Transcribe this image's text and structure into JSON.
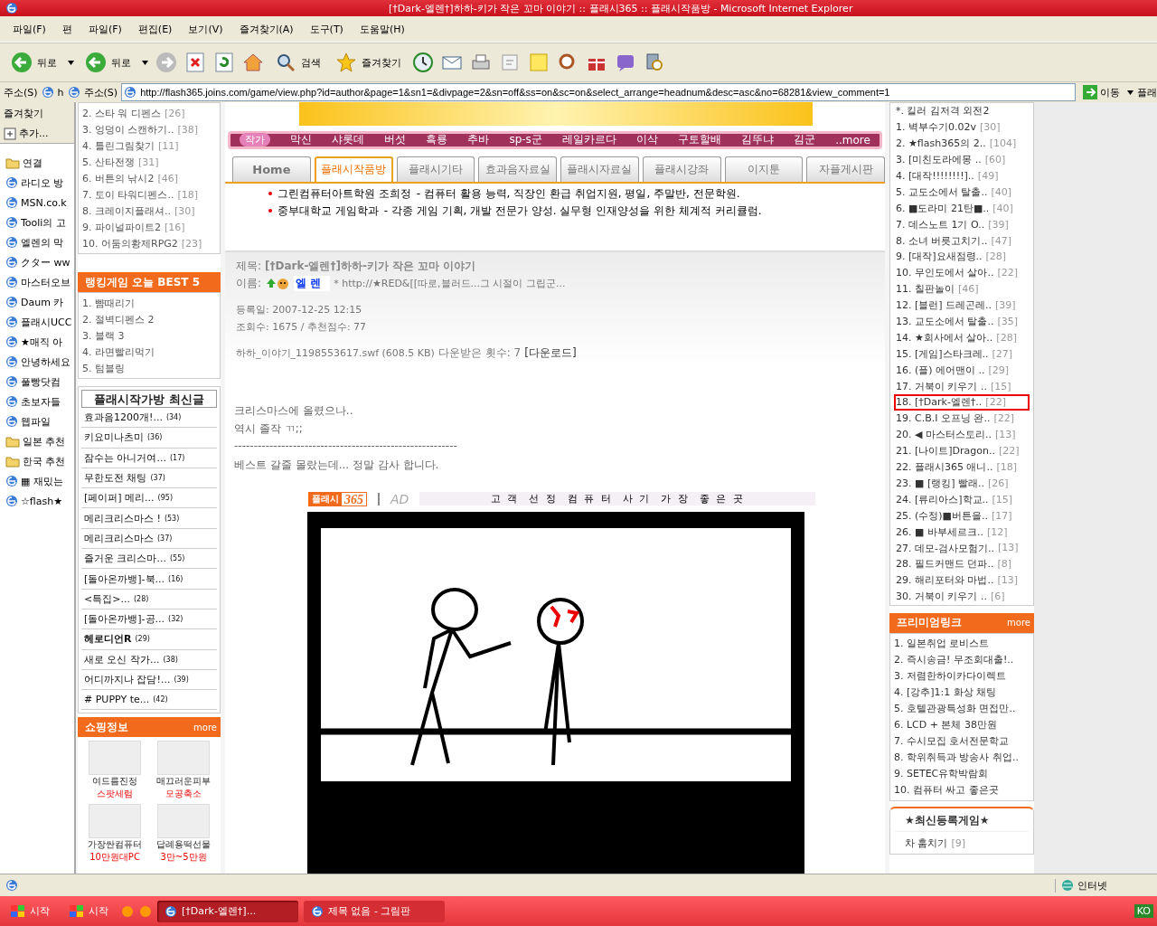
{
  "window": {
    "title": "[†Dark-엘렌†]하하-키가 작은 꼬마 이야기 :: 플래시365 :: 플래시작품방 - Microsoft Internet Explorer"
  },
  "menu": [
    "파일(F)",
    "편",
    "파일(F)",
    "편집(E)",
    "보기(V)",
    "즐겨찾기(A)",
    "도구(T)",
    "도움말(H)"
  ],
  "toolbar": {
    "back_buttons": [
      "뒤로",
      "뒤로"
    ],
    "search": "검색",
    "favorites": "즐겨찾기"
  },
  "address": {
    "labels": [
      "주소(S)",
      "h",
      "주소(S)"
    ],
    "url": "http://flash365.joins.com/game/view.php?id=author&page=1&sn1=&divpage=2&sn=off&ss=on&sc=on&select_arrange=headnum&desc=asc&no=68281&view_comment=1",
    "go": "이동",
    "links": "플래"
  },
  "favorites_pane": {
    "title": "즐겨찾기",
    "add": "추가...",
    "items": [
      {
        "kind": "folder",
        "label": "연결"
      },
      {
        "kind": "page",
        "label": "라디오 방"
      },
      {
        "kind": "page",
        "label": "MSN.co.k"
      },
      {
        "kind": "page",
        "label": "Tooli의 고"
      },
      {
        "kind": "page",
        "label": "엘렌의 막"
      },
      {
        "kind": "page",
        "label": "クター ww"
      },
      {
        "kind": "page",
        "label": "마스터오브"
      },
      {
        "kind": "page",
        "label": "Daum 카"
      },
      {
        "kind": "page",
        "label": "플래시UCC"
      },
      {
        "kind": "page",
        "label": "★매직 아"
      },
      {
        "kind": "page",
        "label": "안녕하세요"
      },
      {
        "kind": "page",
        "label": "풀빵닷컴"
      },
      {
        "kind": "page",
        "label": "초보자들"
      },
      {
        "kind": "page",
        "label": "웹파일"
      },
      {
        "kind": "folder",
        "label": "일본 추천"
      },
      {
        "kind": "folder",
        "label": "한국 추천"
      },
      {
        "kind": "page",
        "label": "▦ 재밌는"
      },
      {
        "kind": "page",
        "label": "☆flash★"
      }
    ]
  },
  "popular": [
    {
      "rank": "2.",
      "title": "스타 워 디펜스",
      "count": "[26]"
    },
    {
      "rank": "3.",
      "title": "엉덩이 스캔하기..",
      "count": "[38]"
    },
    {
      "rank": "4.",
      "title": "틀린그림찾기",
      "count": "[11]"
    },
    {
      "rank": "5.",
      "title": "산타전쟁",
      "count": "[31]"
    },
    {
      "rank": "6.",
      "title": "버튼의 낚시2",
      "count": "[46]"
    },
    {
      "rank": "7.",
      "title": "토이 타워디펜스..",
      "count": "[18]"
    },
    {
      "rank": "8.",
      "title": "크레이지플래셔..",
      "count": "[30]"
    },
    {
      "rank": "9.",
      "title": "파이널파이트2",
      "count": "[16]"
    },
    {
      "rank": "10.",
      "title": "어둠의황제RPG2",
      "count": "[23]"
    }
  ],
  "ranking": {
    "title": "랭킹게임 오늘 BEST 5",
    "items": [
      "1. 뺨때리기",
      "2. 절벽디펜스 2",
      "3. 블랙 3",
      "4. 라면빨리먹기",
      "5. 텀블링"
    ]
  },
  "latest": {
    "title": "플래시작가방 최신글",
    "items": [
      {
        "title": "효과음1200개!...",
        "count": "(34)",
        "bold": false
      },
      {
        "title": "키요미나츠미",
        "count": "(36)",
        "bold": false
      },
      {
        "title": "잠수는 아니거여...",
        "count": "(17)",
        "bold": false
      },
      {
        "title": "무한도전 채팅",
        "count": "(37)",
        "bold": false
      },
      {
        "title": "[페이퍼] 메리...",
        "count": "(95)",
        "bold": false
      },
      {
        "title": "메리크리스마스 !",
        "count": "(53)",
        "bold": false
      },
      {
        "title": "메리크리스마스",
        "count": "(37)",
        "bold": false
      },
      {
        "title": "즐거운 크리스마...",
        "count": "(55)",
        "bold": false
      },
      {
        "title": "[돌아온까뱅]-북...",
        "count": "(16)",
        "bold": false
      },
      {
        "title": "<특집>...",
        "count": "(28)",
        "bold": false
      },
      {
        "title": "[돌아온까뱅]-공...",
        "count": "(32)",
        "bold": false
      },
      {
        "title": "헤로디언R",
        "count": "(29)",
        "bold": true
      },
      {
        "title": "새로 오신 작가...",
        "count": "(38)",
        "bold": false
      },
      {
        "title": "어디까지나 잡담!...",
        "count": "(39)",
        "bold": false
      },
      {
        "title": "# PUPPY te...",
        "count": "(42)",
        "bold": false
      }
    ]
  },
  "shopping": {
    "title": "쇼핑정보",
    "more": "more",
    "items": [
      {
        "name": "여드름진정",
        "promo": "스팟세럼"
      },
      {
        "name": "매끄러운피부",
        "promo": "모공축소"
      },
      {
        "name": "가장싼컴퓨터",
        "promo": "10만원대PC"
      },
      {
        "name": "답례용떡선물",
        "promo": "3만~5만원"
      }
    ]
  },
  "author_bar": {
    "label": "작가",
    "names": [
      "막신",
      "샤롯데",
      "버섯",
      "흑룡",
      "추바",
      "sp-s군",
      "레일카르다",
      "이삭",
      "구토할배",
      "김뚜냐",
      "김군"
    ],
    "more": "..more"
  },
  "tabs": [
    {
      "label": "Home",
      "selected": false
    },
    {
      "label": "플래시작품방",
      "selected": true
    },
    {
      "label": "플래시기타",
      "selected": false
    },
    {
      "label": "효과음자료실",
      "selected": false
    },
    {
      "label": "플래시자료실",
      "selected": false
    },
    {
      "label": "플래시강좌",
      "selected": false
    },
    {
      "label": "이지툰",
      "selected": false
    },
    {
      "label": "자플게시판",
      "selected": false
    }
  ],
  "ads": [
    {
      "title": "그린컴퓨터아트학원 조희정",
      "desc": "- 컴퓨터 활용 능력, 직장인 환급 취업지원, 평일, 주말반, 전문학원."
    },
    {
      "title": "중부대학교 게임학과",
      "desc": "- 각종 게임 기획, 개발 전문가 양성. 실무형 인재양성을 위한 체계적 커리큘럼."
    }
  ],
  "post": {
    "title_label": "제목:",
    "title": "[†Dark-엘렌†]하하-키가 작은 꼬마 이야기",
    "name_label": "이름:",
    "name": "엘 렌",
    "homepage": "* http://★RED&[[따로,블러드...그 시절이 그립군...",
    "date": "등록일: 2007-12-25 12:15",
    "stats": "조회수: 1675 / 추천점수: 77",
    "file": "하하_이야기_1198553617.swf (608.5 KB)",
    "downloads": "다운받은 횟수: 7",
    "download_link": "[다운로드]",
    "body": [
      "크리스마스에 올렸으나..",
      "역시 졸작 ㄲ;;",
      "---------------------------------------------------------",
      "베스트 갈줄 몰랐는데... 정말 감사 합니다."
    ]
  },
  "ad_bar": {
    "logo": "플래시",
    "logo_num": "365",
    "ad": "AD",
    "text": "고 객  선 정  컴 퓨 터  사 기  가 장  좋 은 곳"
  },
  "top_list": [
    {
      "rank": "*.",
      "title": "킬러 김저격 외전2",
      "selected": false
    },
    {
      "rank": "1.",
      "title": "벽부수기0.02v",
      "count": "[30]",
      "selected": false
    },
    {
      "rank": "2.",
      "title": "★flash365의 2..",
      "count": "[104]",
      "selected": false
    },
    {
      "rank": "3.",
      "title": "[미친도라에몽 ..",
      "count": "[60]",
      "selected": false
    },
    {
      "rank": "4.",
      "title": "[대작!!!!!!!!]..",
      "count": "[49]",
      "selected": false
    },
    {
      "rank": "5.",
      "title": "교도소에서 탈출..",
      "count": "[40]",
      "selected": false
    },
    {
      "rank": "6.",
      "title": "■도라미 21탄■..",
      "count": "[40]",
      "selected": false
    },
    {
      "rank": "7.",
      "title": "데스노트 1기 O..",
      "count": "[39]",
      "selected": false
    },
    {
      "rank": "8.",
      "title": "소녀 버릇고치기..",
      "count": "[47]",
      "selected": false
    },
    {
      "rank": "9.",
      "title": "[대작]요새점령..",
      "count": "[28]",
      "selected": false
    },
    {
      "rank": "10.",
      "title": "무인도에서 살아..",
      "count": "[22]",
      "selected": false
    },
    {
      "rank": "11.",
      "title": "칠판놀이",
      "count": "[46]",
      "selected": false
    },
    {
      "rank": "12.",
      "title": "[블런] 드레곤레..",
      "count": "[39]",
      "selected": false
    },
    {
      "rank": "13.",
      "title": "교도소에서 탈출..",
      "count": "[35]",
      "selected": false
    },
    {
      "rank": "14.",
      "title": "★회사에서 살아..",
      "count": "[28]",
      "selected": false
    },
    {
      "rank": "15.",
      "title": "[게임]스타크레..",
      "count": "[27]",
      "selected": false
    },
    {
      "rank": "16.",
      "title": "(플) 에어맨이 ..",
      "count": "[29]",
      "selected": false
    },
    {
      "rank": "17.",
      "title": "거북이 키우기 ..",
      "count": "[15]",
      "selected": false
    },
    {
      "rank": "18.",
      "title": "[†Dark-엘렌†..",
      "count": "[22]",
      "selected": true
    },
    {
      "rank": "19.",
      "title": "C.B.I 오프닝 완..",
      "count": "[22]",
      "selected": false
    },
    {
      "rank": "20.",
      "title": "◀ 마스터스토리..",
      "count": "[13]",
      "selected": false
    },
    {
      "rank": "21.",
      "title": "[나이트]Dragon..",
      "count": "[22]",
      "selected": false
    },
    {
      "rank": "22.",
      "title": "플래시365 애니..",
      "count": "[18]",
      "selected": false
    },
    {
      "rank": "23.",
      "title": "■ [랭킹] 빨래..",
      "count": "[26]",
      "selected": false
    },
    {
      "rank": "24.",
      "title": "[류리아스]학교..",
      "count": "[15]",
      "selected": false
    },
    {
      "rank": "25.",
      "title": "(수정)■버튼을..",
      "count": "[17]",
      "selected": false
    },
    {
      "rank": "26.",
      "title": "■  바부세르크..",
      "count": "[12]",
      "selected": false
    },
    {
      "rank": "27.",
      "title": "데모-검사모험기..",
      "count": "[13]",
      "selected": false
    },
    {
      "rank": "28.",
      "title": "필드커맨드 던파..",
      "count": "[8]",
      "selected": false
    },
    {
      "rank": "29.",
      "title": "해리포터와 마법..",
      "count": "[13]",
      "selected": false
    },
    {
      "rank": "30.",
      "title": "거북이 키우기 ..",
      "count": "[6]",
      "selected": false
    }
  ],
  "premium": {
    "title": "프리미엄링크",
    "more": "more",
    "items": [
      "1. 일본취업 로비스트",
      "2. 즉시송금! 무조회대출!..",
      "3. 저렴한하이카다이렉트",
      "4. [강추]1:1 화상 채팅",
      "5. 호텔관광특성화 면접만..",
      "6. LCD + 본체 38만원",
      "7. 수시모집 호서전문학교",
      "8. 학위취득과 방송사 취업..",
      "9. SETEC유학박람회",
      "10. 컴퓨터 싸고 좋은곳"
    ]
  },
  "new_games": {
    "title": "★최신등록게임★",
    "items": [
      {
        "title": "차 훔치기",
        "count": "[9]"
      }
    ]
  },
  "status_bar": {
    "zone": "인터넷"
  },
  "taskbar": {
    "start": [
      "시작",
      "시작"
    ],
    "tasks": [
      {
        "label": "[†Dark-엘렌†]...",
        "selected": true
      },
      {
        "label": "제목 없음 - 그림판",
        "selected": false
      }
    ],
    "lang": "KO"
  }
}
